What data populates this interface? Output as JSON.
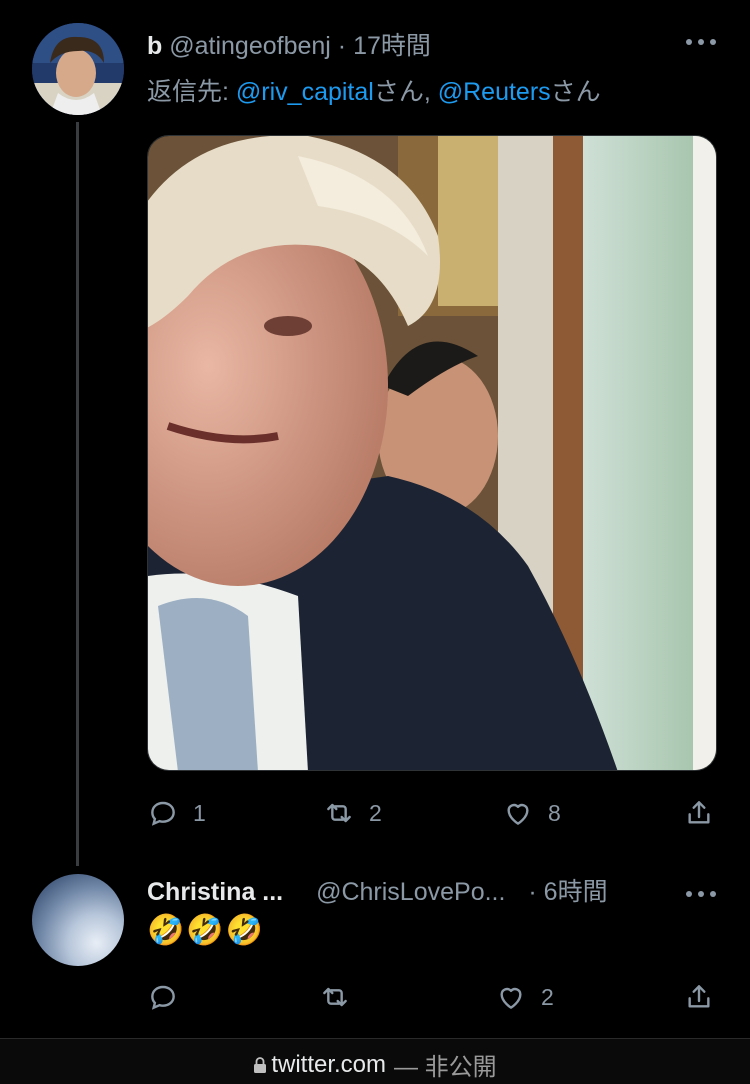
{
  "tweet1": {
    "name": "b",
    "handle": "@atingeofbenj",
    "separator": "·",
    "time": "17時間",
    "reply_prefix": "返信先: ",
    "reply_user1": "@riv_capital",
    "reply_suffix1": "さん, ",
    "reply_user2": "@Reuters",
    "reply_suffix2": "さん",
    "actions": {
      "reply_count": "1",
      "retweet_count": "2",
      "like_count": "8"
    }
  },
  "tweet2": {
    "name": "Christina ...",
    "handle": "@ChrisLovePo...",
    "separator": "·",
    "time": "6時間",
    "content": "🤣🤣🤣",
    "actions": {
      "like_count": "2"
    }
  },
  "browser": {
    "url": "twitter.com",
    "privacy": "— 非公開"
  },
  "colors": {
    "background": "#000000",
    "link": "#1d9bf0",
    "secondary": "#8b98a5"
  }
}
